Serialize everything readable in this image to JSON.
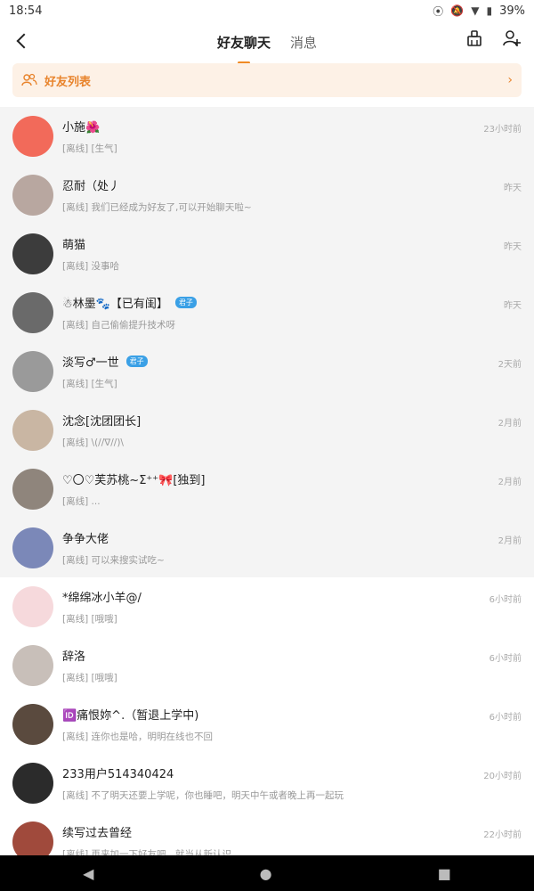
{
  "status": {
    "time": "18:54",
    "battery": "39%"
  },
  "header": {
    "tabs": [
      {
        "label": "好友聊天",
        "active": true
      },
      {
        "label": "消息",
        "active": false
      }
    ]
  },
  "friend_list": {
    "label": "好友列表"
  },
  "chats": [
    {
      "name": "小施🌺",
      "message": "[离线] [生气]",
      "time": "23小时前",
      "avatar_color": "#f26a5a",
      "grey": true
    },
    {
      "name": "忍耐（处丿",
      "message": "[离线] 我们已经成为好友了,可以开始聊天啦~",
      "time": "昨天",
      "avatar_color": "#b8a7a0",
      "grey": true
    },
    {
      "name": "萌猫",
      "message": "[离线] 没事哈",
      "time": "昨天",
      "avatar_color": "#3c3c3c",
      "grey": true
    },
    {
      "name": "☃林墨🐾【已有闺】",
      "message": "[离线] 自己偷偷提升技术呀",
      "time": "昨天",
      "avatar_color": "#6a6a6a",
      "grey": true,
      "badge": "君子"
    },
    {
      "name": "淡写♂一世",
      "message": "[离线] [生气]",
      "time": "2天前",
      "avatar_color": "#9a9a9a",
      "grey": true,
      "badge": "君子"
    },
    {
      "name": "沈念[沈团团长]",
      "message": "[离线] \\(//∇//)\\",
      "time": "2月前",
      "avatar_color": "#c9b6a3",
      "grey": true
    },
    {
      "name": "♡〇♡芙苏桃~Σ⁺⁺🎀[独到]",
      "message": "[离线] ...",
      "time": "2月前",
      "avatar_color": "#8f857c",
      "grey": true
    },
    {
      "name": "争争大佬",
      "message": "[离线] 可以来搜实试吃~",
      "time": "2月前",
      "avatar_color": "#7b88b8",
      "grey": true
    },
    {
      "name": "*绵绵冰小羊@/",
      "message": "[离线] [哦哦]",
      "time": "6小时前",
      "avatar_color": "#f6d9dc",
      "grey": false
    },
    {
      "name": "辞洛",
      "message": "[离线] [哦哦]",
      "time": "6小时前",
      "avatar_color": "#c8bfb9",
      "grey": false
    },
    {
      "name": "🆔痛恨妳^.（暂退上学中)",
      "message": "[离线] 连你也是哈，明明在线也不回",
      "time": "6小时前",
      "avatar_color": "#5a4a3e",
      "grey": false
    },
    {
      "name": "233用户514340424",
      "message": "[离线] 不了明天还要上学呢，你也睡吧，明天中午或者晚上再一起玩",
      "time": "20小时前",
      "avatar_color": "#2b2b2b",
      "grey": false
    },
    {
      "name": "续写过去曾经",
      "message": "[离线] 再来加一下好友吧，就当从新认识",
      "time": "22小时前",
      "avatar_color": "#a04a3c",
      "grey": false
    }
  ]
}
